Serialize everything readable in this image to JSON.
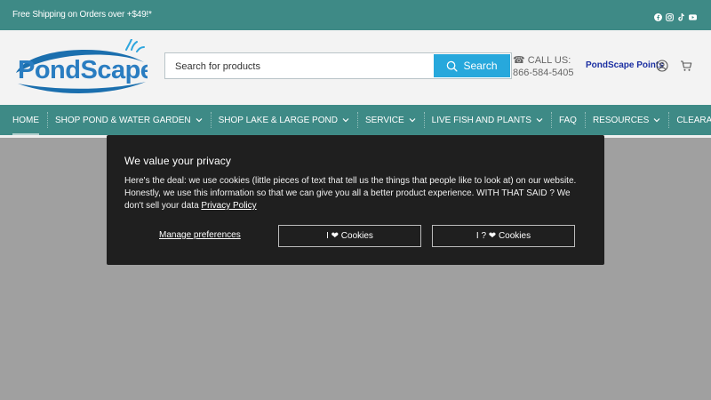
{
  "topbar": {
    "promo": "Free Shipping on Orders over +$49!*",
    "social_icons": [
      "facebook-icon",
      "instagram-icon",
      "tiktok-icon",
      "youtube-icon"
    ]
  },
  "header": {
    "logo_text": "PondScape",
    "search_placeholder": "Search for products",
    "search_button": "Search",
    "call_label": "☎ CALL US:",
    "call_number": "866-584-5405",
    "points": "PondScape Points"
  },
  "nav": {
    "items": [
      {
        "label": "HOME",
        "dropdown": false
      },
      {
        "label": "SHOP POND & WATER GARDEN",
        "dropdown": true
      },
      {
        "label": "SHOP LAKE & LARGE POND",
        "dropdown": true
      },
      {
        "label": "SERVICE",
        "dropdown": true
      },
      {
        "label": "LIVE FISH AND PLANTS",
        "dropdown": true
      },
      {
        "label": "FAQ",
        "dropdown": false
      },
      {
        "label": "RESOURCES",
        "dropdown": true
      },
      {
        "label": "CLEARANCE",
        "dropdown": false
      }
    ]
  },
  "cookie": {
    "title": "We value your privacy",
    "body": "Here's the deal: we use cookies (little pieces of text that tell us the things that people like to look at) on our website. Honestly, we use this information so that we can give you all a better product experience. WITH THAT SAID ? We don't sell your data ",
    "link": "Privacy Policy",
    "manage": "Manage preferences",
    "btn1": "I ❤ Cookies",
    "btn2": "I ? ❤ Cookies"
  },
  "colors": {
    "brand_teal": "#3e8a86",
    "search_blue": "#27a8dc",
    "points_blue": "#1b2fa2",
    "modal_bg": "#1f1f1f",
    "overlay": "#a0a0a0"
  }
}
